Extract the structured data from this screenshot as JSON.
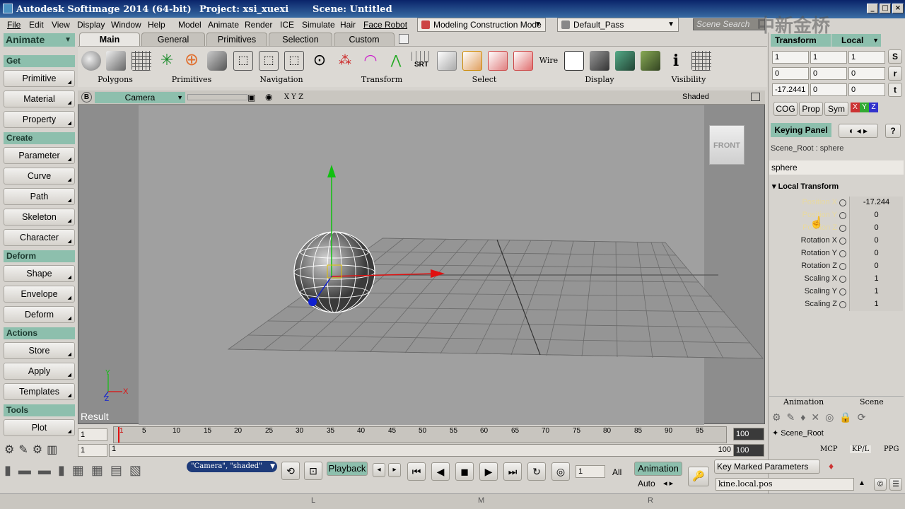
{
  "app": {
    "title": "Autodesk Softimage 2014 (64-bit)",
    "project": "Project: xsi_xuexi",
    "scene": "Scene: Untitled",
    "watermark": "中新金桥"
  },
  "menu": [
    "File",
    "Edit",
    "View",
    "Display",
    "Window",
    "Help",
    "Model",
    "Animate",
    "Render",
    "ICE",
    "Simulate",
    "Hair",
    "Face Robot"
  ],
  "mode_dropdown": "Modeling Construction Mode",
  "pass_dropdown": "Default_Pass",
  "scene_search_placeholder": "Scene Search",
  "module_dropdown": "Animate",
  "left_sections": {
    "get": "Get",
    "get_items": [
      "Primitive",
      "Material",
      "Property"
    ],
    "create": "Create",
    "create_items": [
      "Parameter",
      "Curve",
      "Path",
      "Skeleton",
      "Character"
    ],
    "deform": "Deform",
    "deform_items": [
      "Shape",
      "Envelope",
      "Deform"
    ],
    "actions": "Actions",
    "actions_items": [
      "Store",
      "Apply",
      "Templates"
    ],
    "tools": "Tools",
    "tools_items": [
      "Plot"
    ]
  },
  "toolbar_tabs": [
    "Main",
    "General",
    "Primitives",
    "Selection",
    "Custom"
  ],
  "toolbar_groups": [
    "Polygons",
    "Primitives",
    "Navigation",
    "Transform",
    "Select",
    "Display",
    "Visibility"
  ],
  "toolbar_icon_text": {
    "srt": "SRT",
    "wire": "Wire",
    "info": "i"
  },
  "viewport": {
    "b_label": "B",
    "camera": "Camera",
    "xyz": "X Y Z",
    "shading": "Shaded",
    "cube_label": "FRONT",
    "result_label": "Result",
    "axis_y": "Y",
    "axis_x": "X",
    "axis_z": "Z"
  },
  "transform_panel": {
    "transform_btn": "Transform",
    "local_dd": "Local",
    "scale": [
      "1",
      "1",
      "1"
    ],
    "rotate": [
      "0",
      "0",
      "0"
    ],
    "translate": [
      "-17.2441",
      "0",
      "0"
    ],
    "s_btn": "S",
    "r_btn": "r",
    "t_btn": "t",
    "cog": "COG",
    "prop": "Prop",
    "sym": "Sym",
    "xyz_btns": [
      "X",
      "Y",
      "Z"
    ]
  },
  "keying": {
    "keying_panel": "Keying Panel",
    "help": "?",
    "path": "Scene_Root : sphere",
    "object": "sphere",
    "section": "Local Transform",
    "params": [
      {
        "label": "Position X",
        "value": "-17.244"
      },
      {
        "label": "Position Y",
        "value": "0"
      },
      {
        "label": "Position Z",
        "value": "0"
      },
      {
        "label": "Rotation X",
        "value": "0"
      },
      {
        "label": "Rotation Y",
        "value": "0"
      },
      {
        "label": "Rotation Z",
        "value": "0"
      },
      {
        "label": "Scaling X",
        "value": "1"
      },
      {
        "label": "Scaling Y",
        "value": "1"
      },
      {
        "label": "Scaling Z",
        "value": "1"
      }
    ]
  },
  "explorer": {
    "tabs": [
      "Animation",
      "Scene"
    ],
    "root": "Scene_Root",
    "bottom_tabs": [
      "MCP",
      "KP/L",
      "PPG"
    ]
  },
  "timeline": {
    "start": "1",
    "end": "100",
    "current": "1",
    "range_start": "1",
    "range_start2": "1",
    "range_end": "100",
    "range_end2": "100",
    "ticks": [
      "1",
      "5",
      "10",
      "15",
      "20",
      "25",
      "30",
      "35",
      "40",
      "45",
      "50",
      "55",
      "60",
      "65",
      "70",
      "75",
      "80",
      "85",
      "90",
      "95"
    ]
  },
  "bottom": {
    "view_info": "\"Camera\", \"shaded\"",
    "playback": "Playback",
    "frame": "1",
    "all": "All",
    "animation": "Animation",
    "auto": "Auto",
    "key_marked": "Key Marked Parameters",
    "kine_field": "kine.local.pos"
  },
  "status": {
    "l": "L",
    "m": "M",
    "r": "R"
  },
  "colors": {
    "accent_green": "#8dbfad",
    "viewport_bg": "#8d8d8d",
    "x_axis": "#e01010",
    "y_axis": "#10c010",
    "z_axis": "#1020d0"
  }
}
